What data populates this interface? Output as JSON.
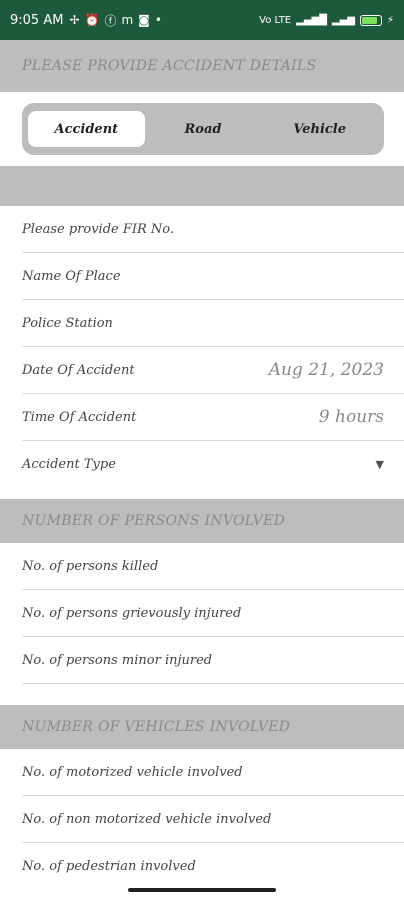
{
  "status_bar": {
    "time": "9:05 AM",
    "left_icons": [
      "fan-icon",
      "alarm-icon",
      "app-f-icon",
      "app-m-icon",
      "instagram-icon"
    ],
    "dot": "•",
    "net_label": "Vo LTE",
    "battery_color": "#7ce05c",
    "bar_color": "#1c5a3a"
  },
  "header1": "PLEASE PROVIDE ACCIDENT DETAILS",
  "tabs": [
    {
      "label": "Accident",
      "active": true
    },
    {
      "label": "Road",
      "active": false
    },
    {
      "label": "Vehicle",
      "active": false
    }
  ],
  "accident_fields": {
    "fir": "Please provide FIR No.",
    "place": "Name Of Place",
    "police": "Police Station",
    "date_label": "Date Of Accident",
    "date_value": "Aug 21, 2023",
    "time_label": "Time Of Accident",
    "time_value": "9 hours",
    "type_label": "Accident Type"
  },
  "header2": "NUMBER OF PERSONS INVOLVED",
  "persons": {
    "killed": "No. of persons killed",
    "grievous": "No. of persons grievously injured",
    "minor": "No. of persons minor injured"
  },
  "header3": "NUMBER OF VEHICLES INVOLVED",
  "vehicles": {
    "motorized": "No. of motorized vehicle involved",
    "non_motorized": "No. of non motorized vehicle involved",
    "pedestrian": "No. of pedestrian involved"
  }
}
